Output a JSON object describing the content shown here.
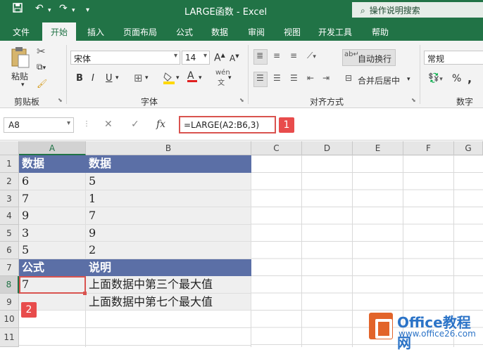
{
  "titlebar": {
    "title": "LARGE函数  -  Excel",
    "tellme": "操作说明搜索"
  },
  "tabs": [
    "文件",
    "开始",
    "插入",
    "页面布局",
    "公式",
    "数据",
    "审阅",
    "视图",
    "开发工具",
    "帮助"
  ],
  "ribbon": {
    "paste_label": "粘贴",
    "clipboard_label": "剪贴板",
    "font_name": "宋体",
    "font_size": "14",
    "bold": "B",
    "italic": "I",
    "underline": "U",
    "font_label": "字体",
    "wrap_text": "自动换行",
    "merge_center": "合并后居中",
    "alignment_label": "对齐方式",
    "number_format": "常规",
    "number_label": "数字",
    "percent": "%",
    "comma": ","
  },
  "formula_bar": {
    "name_box": "A8",
    "formula": "=LARGE(A2:B6,3)",
    "badge1": "1"
  },
  "columns": [
    "A",
    "B",
    "C",
    "D",
    "E",
    "F",
    "G"
  ],
  "rows": [
    "1",
    "2",
    "3",
    "4",
    "5",
    "6",
    "7",
    "8",
    "9",
    "10",
    "11"
  ],
  "cells": {
    "a1": "数据",
    "b1": "数据",
    "a2": "6",
    "b2": "5",
    "a3": "7",
    "b3": "1",
    "a4": "9",
    "b4": "7",
    "a5": "3",
    "b5": "9",
    "a6": "5",
    "b6": "2",
    "a7": "公式",
    "b7": "说明",
    "a8": "7",
    "b8": "上面数据中第三个最大值",
    "a9": "",
    "b9": "上面数据中第七个最大值"
  },
  "badge2": "2",
  "watermark": {
    "title": "Office教程网",
    "sub": "www.office26.com"
  }
}
